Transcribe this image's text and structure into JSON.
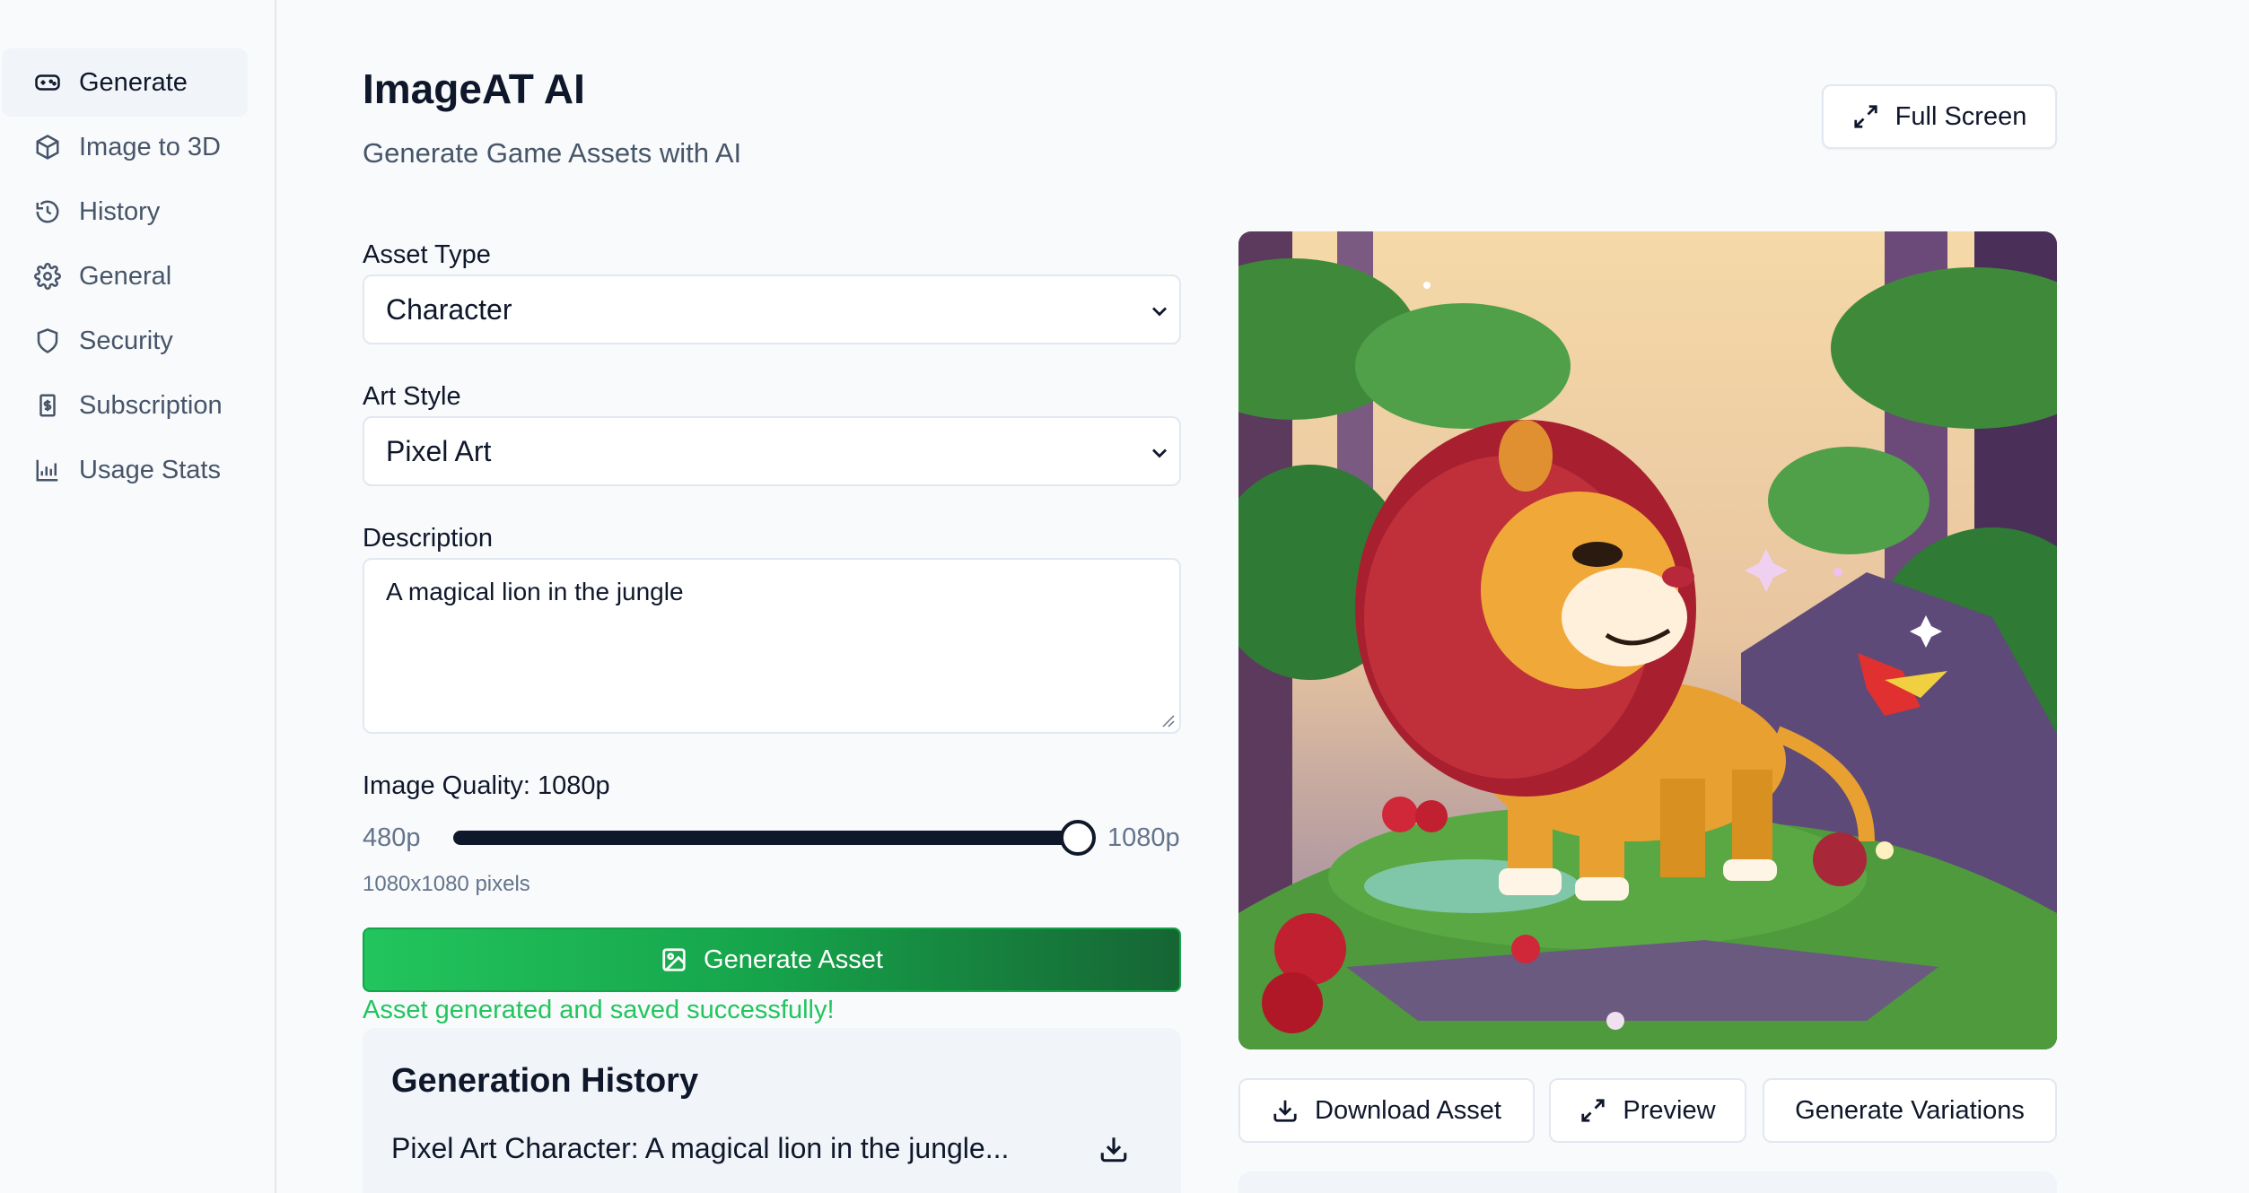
{
  "sidebar": {
    "items": [
      {
        "label": "Generate",
        "icon": "gamepad-icon",
        "active": true
      },
      {
        "label": "Image to 3D",
        "icon": "cube-icon"
      },
      {
        "label": "History",
        "icon": "history-icon"
      },
      {
        "label": "General",
        "icon": "gear-icon"
      },
      {
        "label": "Security",
        "icon": "shield-icon"
      },
      {
        "label": "Subscription",
        "icon": "receipt-icon"
      },
      {
        "label": "Usage Stats",
        "icon": "bar-chart-icon"
      }
    ]
  },
  "header": {
    "title": "ImageAT AI",
    "subtitle": "Generate Game Assets with AI",
    "fullscreen_label": "Full Screen"
  },
  "form": {
    "asset_type_label": "Asset Type",
    "asset_type_value": "Character",
    "art_style_label": "Art Style",
    "art_style_value": "Pixel Art",
    "description_label": "Description",
    "description_value": "A magical lion in the jungle",
    "quality_label": "Image Quality: 1080p",
    "quality_min": "480p",
    "quality_max": "1080p",
    "quality_fraction": 1.0,
    "pixels_text": "1080x1080 pixels",
    "generate_label": "Generate Asset",
    "success_message": "Asset generated and saved successfully!"
  },
  "history": {
    "title": "Generation History",
    "items": [
      {
        "label": "Pixel Art Character: A magical lion in the jungle..."
      }
    ]
  },
  "preview": {
    "download_label": "Download Asset",
    "preview_label": "Preview",
    "variations_label": "Generate Variations"
  },
  "colors": {
    "accent_green": "#22c55e",
    "accent_green_dark": "#166534",
    "text_primary": "#0f172a",
    "text_muted": "#64748b"
  }
}
